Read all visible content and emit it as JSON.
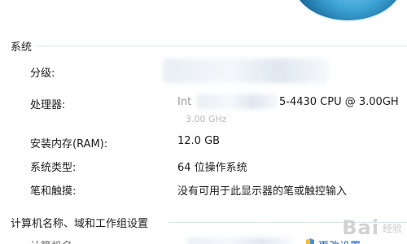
{
  "system_section": {
    "title": "系统",
    "rows": [
      {
        "label": "分级:",
        "value": ""
      },
      {
        "label": "处理器:",
        "value": "5-4430 CPU @ 3.00GH",
        "value_prefix": "Int",
        "subvalue": "3.00 GHz"
      },
      {
        "label": "安装内存(RAM):",
        "value": "12.0 GB"
      },
      {
        "label": "系统类型:",
        "value": "64 位操作系统"
      },
      {
        "label": "笔和触摸:",
        "value": "没有可用于此显示器的笔或触控输入"
      }
    ]
  },
  "computer_section": {
    "title": "计算机名称、域和工作组设置",
    "first_row": {
      "label": "计算机名",
      "link": "更改设置"
    }
  },
  "watermark": {
    "text": "Bai",
    "sub": "经验"
  },
  "colors": {
    "link": "#1a5fb4",
    "line": "#dde6ee"
  }
}
